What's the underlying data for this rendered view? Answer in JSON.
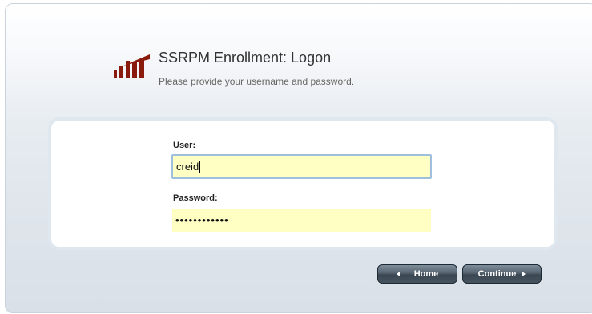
{
  "header": {
    "title": "SSRPM Enrollment: Logon",
    "subtitle": "Please provide your username and password."
  },
  "form": {
    "user_label": "User:",
    "user_value": "creid",
    "password_label": "Password:",
    "password_value": "••••••••••••"
  },
  "buttons": {
    "home_label": "Home",
    "continue_label": "Continue"
  },
  "icons": {
    "logo": "ssrpm-logo-icon",
    "home_arrow": "left-arrow-icon",
    "continue_arrow": "right-arrow-icon"
  },
  "colors": {
    "input_background": "#ffffc4",
    "input_focus_border": "#9fc0dc",
    "button_background": "#4a5763",
    "logo_color": "#8b1a0e"
  }
}
